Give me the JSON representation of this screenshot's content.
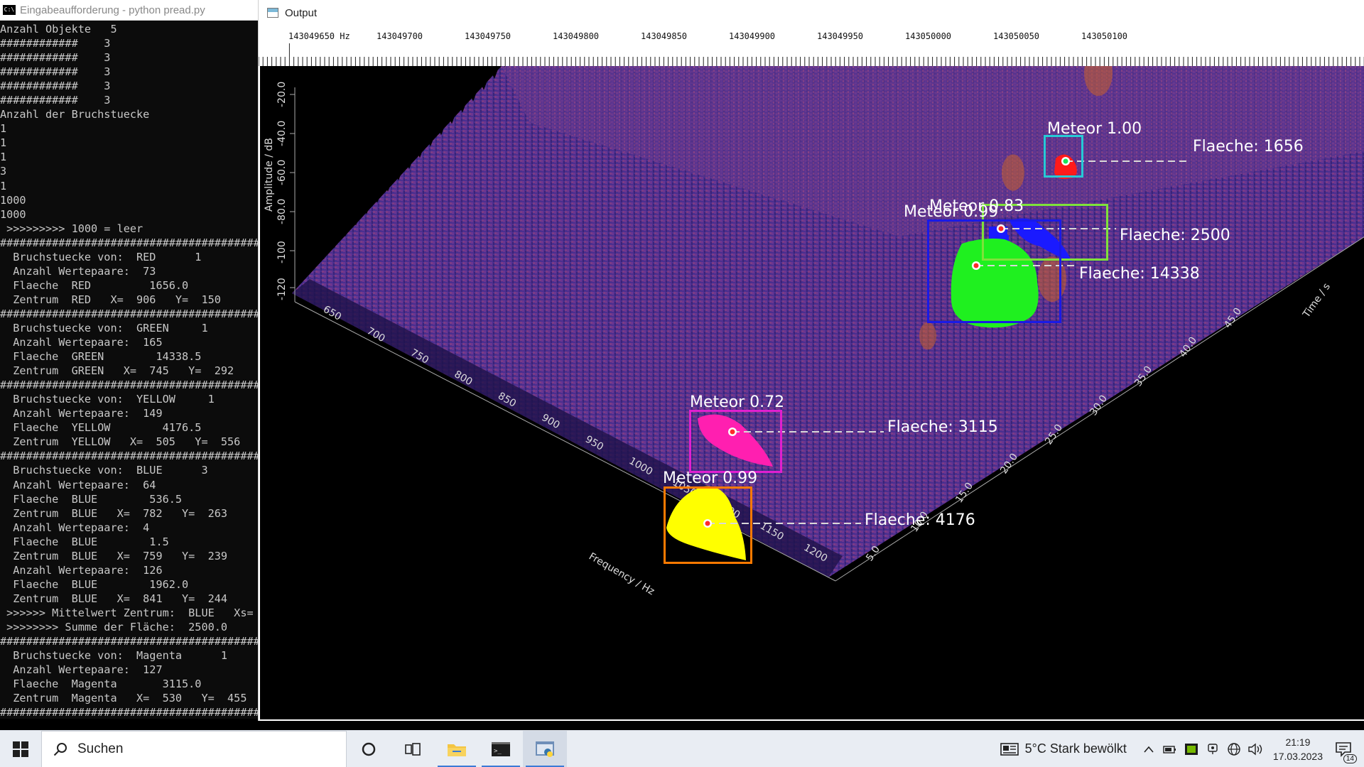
{
  "console": {
    "title": "Eingabeaufforderung - python  pread.py",
    "lines": [
      "Anzahl Objekte   5",
      "############    3",
      "############    3",
      "############    3",
      "############    3",
      "############    3",
      "Anzahl der Bruchstuecke",
      "1",
      "1",
      "1",
      "3",
      "1",
      "1000",
      "1000",
      " >>>>>>>>> 1000 = leer",
      "#############################################",
      "  Bruchstuecke von:  RED      1",
      "  Anzahl Wertepaare:  73",
      "  Flaeche  RED         1656.0",
      "  Zentrum  RED   X=  906   Y=  150",
      "#############################################",
      "  Bruchstuecke von:  GREEN     1",
      "  Anzahl Wertepaare:  165",
      "  Flaeche  GREEN        14338.5",
      "  Zentrum  GREEN   X=  745   Y=  292",
      "#############################################",
      "  Bruchstuecke von:  YELLOW     1",
      "  Anzahl Wertepaare:  149",
      "  Flaeche  YELLOW        4176.5",
      "  Zentrum  YELLOW   X=  505   Y=  556",
      "#############################################",
      "  Bruchstuecke von:  BLUE      3",
      "  Anzahl Wertepaare:  64",
      "  Flaeche  BLUE        536.5",
      "  Zentrum  BLUE   X=  782   Y=  263",
      "  Anzahl Wertepaare:  4",
      "  Flaeche  BLUE        1.5",
      "  Zentrum  BLUE   X=  759   Y=  239",
      "  Anzahl Wertepaare:  126",
      "  Flaeche  BLUE        1962.0",
      "  Zentrum  BLUE   X=  841   Y=  244",
      " >>>>>> Mittelwert Zentrum:  BLUE   Xs=",
      " >>>>>>>> Summe der Fläche:  2500.0",
      "#############################################",
      "  Bruchstuecke von:  Magenta      1",
      "  Anzahl Wertepaare:  127",
      "  Flaeche  Magenta       3115.0",
      "  Zentrum  Magenta   X=  530   Y=  455",
      "#############################################"
    ]
  },
  "output": {
    "title": "Output",
    "freq_ticks": [
      "143049650 Hz",
      "143049700",
      "143049750",
      "143049800",
      "143049850",
      "143049900",
      "143049950",
      "143050000",
      "143050050",
      "143050100"
    ],
    "axis_amplitude_label": "Amplitude / dB",
    "axis_amplitude_ticks": [
      "-20.0",
      "-40.0",
      "-60.0",
      "-80.0",
      "-100",
      "-120"
    ],
    "axis_frequency_label": "Frequency / Hz",
    "axis_frequency_ticks": [
      "650",
      "700",
      "750",
      "800",
      "850",
      "900",
      "950",
      "1000",
      "1050",
      "1100",
      "1150",
      "1200"
    ],
    "axis_time_label": "Time / s",
    "axis_time_ticks": [
      "5.0",
      "10.0",
      "15.0",
      "20.0",
      "25.0",
      "30.0",
      "35.0",
      "40.0",
      "45.0"
    ],
    "detections": [
      {
        "label": "Meteor 1.00",
        "area_label": "Flaeche:   1656",
        "fill": "#ff1a1a",
        "box": "#27c9d6",
        "center_dot": "#17e85a"
      },
      {
        "label": "Meteor 0.83",
        "area_label": "Flaeche:   2500",
        "fill": "#1a1aff",
        "box": "#7ee23a",
        "center_dot": "#ff2a2a"
      },
      {
        "label": "Meteor 0.99",
        "area_label": "Flaeche:  14338",
        "fill": "#1ff01f",
        "box": "#1a1ae6",
        "center_dot": "#ff2a2a"
      },
      {
        "label": "Meteor 0.72",
        "area_label": "Flaeche:   3115",
        "fill": "#ff1fb0",
        "box": "#e01fd0",
        "center_dot": "#ff2a2a"
      },
      {
        "label": "Meteor 0.99",
        "area_label": "Flaeche:   4176",
        "fill": "#ffff00",
        "box": "#ff7a00",
        "center_dot": "#ff2a2a"
      }
    ]
  },
  "taskbar": {
    "search_placeholder": "Suchen",
    "weather": "5°C  Stark bewölkt",
    "time": "21:19",
    "date": "17.03.2023",
    "notification_count": "14"
  },
  "colors": {
    "console_bg": "#0c0c0c",
    "console_text": "#c8c8c8",
    "plot_bg": "#000000",
    "surface_base": "#3a2a8a",
    "surface_peak": "#b8432a",
    "taskbar_bg": "#e9edf3",
    "taskbar_accent": "#3b7ad6"
  }
}
